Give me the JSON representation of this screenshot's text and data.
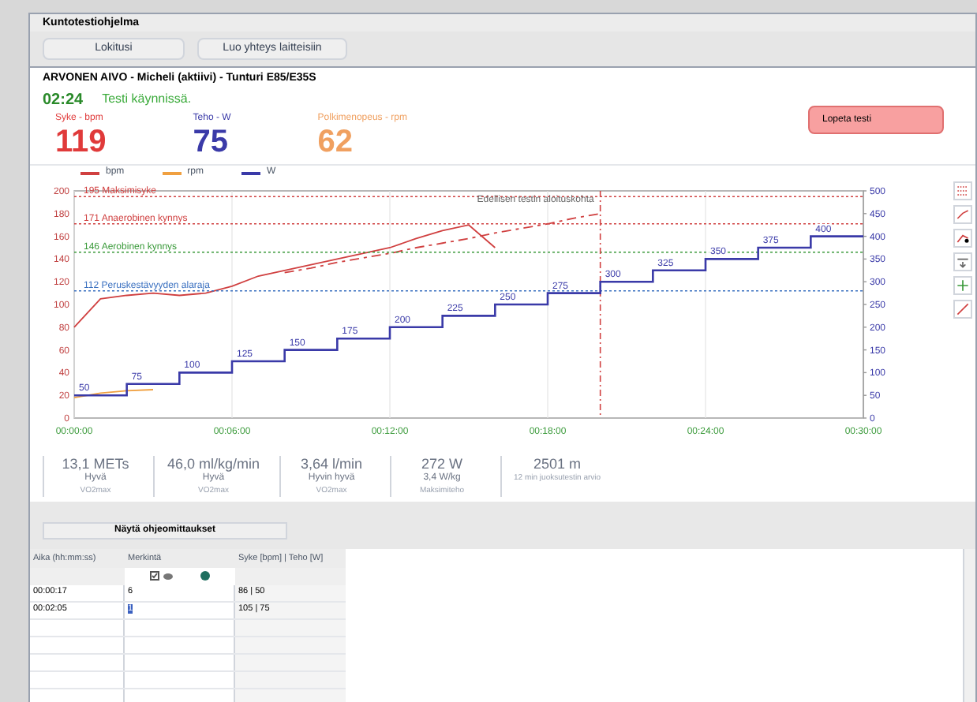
{
  "window": {
    "title": "Kuntotestiohjelma"
  },
  "toolbar": {
    "buttons": [
      "Lokitusi",
      "Luo yhteys laitteisiin"
    ]
  },
  "subject": "ARVONEN AIVO - Micheli (aktiivi) - Tunturi E85/E35S",
  "status": {
    "time": "02:24",
    "text": "Testi käynnissä."
  },
  "readouts": [
    {
      "label": "Syke - bpm",
      "value": "119",
      "color": "#e03a3a"
    },
    {
      "label": "Teho - W",
      "value": "75",
      "color": "#3a3aa8"
    },
    {
      "label": "Polkimenopeus - rpm",
      "value": "62",
      "color": "#f0a060"
    }
  ],
  "stop_button": "Lopeta testi",
  "chart": {
    "chart_data": {
      "type": "line",
      "x": [
        0,
        1,
        2,
        3,
        4,
        5,
        6,
        7,
        8,
        9,
        10,
        11,
        12,
        13,
        14,
        15,
        16,
        17,
        18,
        19,
        20
      ],
      "xticks": [
        {
          "value": 0,
          "label": "00:00:00"
        },
        {
          "value": 6,
          "label": "00:06:00"
        },
        {
          "value": 12,
          "label": "00:12:00"
        },
        {
          "value": 18,
          "label": "00:18:00"
        },
        {
          "value": 24,
          "label": "00:24:00"
        },
        {
          "value": 30,
          "label": "00:30:00"
        }
      ],
      "xlim": [
        0,
        30
      ],
      "ylim": [
        0,
        200
      ],
      "yticks": [
        0,
        20,
        40,
        60,
        80,
        100,
        120,
        140,
        160,
        180,
        200
      ],
      "grid": true,
      "series": [
        {
          "name": "bpm",
          "color": "#d04040",
          "values": [
            80,
            105,
            108,
            110,
            108,
            110,
            116,
            125,
            130,
            135,
            140,
            145,
            150,
            158,
            165,
            170,
            150,
            null,
            null,
            null,
            null
          ]
        },
        {
          "name": "rpm",
          "color": "#f0a040",
          "values": [
            18,
            22,
            24,
            25,
            null,
            null,
            null,
            null,
            null,
            null,
            null,
            null,
            null,
            null,
            null,
            null,
            null,
            null,
            null,
            null,
            null
          ]
        },
        {
          "color": "#d04040",
          "line_style": "dashed",
          "values": [
            null,
            null,
            null,
            null,
            null,
            null,
            null,
            null,
            128,
            132,
            137,
            141,
            145,
            150,
            154,
            158,
            163,
            167,
            171,
            176,
            180
          ]
        }
      ],
      "ref_lines": [
        {
          "axis": "y",
          "value": 195,
          "label": "195 Maksimisyke",
          "color": "#d04040"
        },
        {
          "axis": "y",
          "value": 171,
          "label": "171 Anaerobinen kynnys",
          "color": "#d04040"
        },
        {
          "axis": "y",
          "value": 146,
          "label": "146 Aerobinen kynnys",
          "color": "#3a9a3a"
        },
        {
          "axis": "y",
          "value": 112,
          "label": "112 Peruskestävyyden alaraja",
          "color": "#3a70c0"
        },
        {
          "axis": "x",
          "value": 20,
          "label": "Edellisen testin aloituskohta",
          "color": "#d04040"
        }
      ]
    }
  },
  "power_overlay": {
    "chart_data": {
      "type": "line",
      "x": [
        0,
        2,
        2,
        4,
        4,
        6,
        6,
        8,
        8,
        10,
        10,
        12,
        12,
        14,
        14,
        16,
        16,
        18,
        18,
        20,
        20,
        22,
        22,
        24,
        24,
        26,
        26,
        28,
        28,
        30
      ],
      "xlim": [
        0,
        30
      ],
      "ylim": [
        0,
        500
      ],
      "yticks": [
        0,
        50,
        100,
        150,
        200,
        250,
        300,
        350,
        400,
        450,
        500
      ],
      "series": [
        {
          "name": "W",
          "color": "#3a3aa8",
          "values": [
            50,
            50,
            75,
            75,
            100,
            100,
            125,
            125,
            150,
            150,
            175,
            175,
            200,
            200,
            225,
            225,
            250,
            250,
            275,
            275,
            300,
            300,
            325,
            325,
            350,
            350,
            375,
            375,
            400,
            400
          ]
        }
      ],
      "annotations": [
        {
          "x": 0,
          "y": 50,
          "text": "50"
        },
        {
          "x": 2,
          "y": 75,
          "text": "75"
        },
        {
          "x": 4,
          "y": 100,
          "text": "100"
        },
        {
          "x": 6,
          "y": 125,
          "text": "125"
        },
        {
          "x": 8,
          "y": 150,
          "text": "150"
        },
        {
          "x": 10,
          "y": 175,
          "text": "175"
        },
        {
          "x": 12,
          "y": 200,
          "text": "200"
        },
        {
          "x": 14,
          "y": 225,
          "text": "225"
        },
        {
          "x": 16,
          "y": 250,
          "text": "250"
        },
        {
          "x": 18,
          "y": 275,
          "text": "275"
        },
        {
          "x": 20,
          "y": 300,
          "text": "300"
        },
        {
          "x": 22,
          "y": 325,
          "text": "325"
        },
        {
          "x": 24,
          "y": 350,
          "text": "350"
        },
        {
          "x": 26,
          "y": 375,
          "text": "375"
        },
        {
          "x": 28,
          "y": 400,
          "text": "400"
        }
      ]
    }
  },
  "summary_cards": [
    {
      "value": "13,1 METs",
      "rating": "Hyvä",
      "caption": "VO2max"
    },
    {
      "value": "46,0 ml/kg/min",
      "rating": "Hyvä",
      "caption": "VO2max"
    },
    {
      "value": "3,64 l/min",
      "rating": "Hyvin hyvä",
      "caption": "VO2max"
    },
    {
      "value": "272 W",
      "rating": "3,4 W/kg",
      "caption": "Maksimiteho"
    },
    {
      "value": "2501 m",
      "caption": "12 min juoksutestin arvio"
    }
  ],
  "notes_button": "Näytä ohjeomittaukset",
  "table": {
    "columns": [
      "Aika (hh:mm:ss)",
      "Merkintä",
      "Syke [bpm] | Teho [W]"
    ],
    "rows": [
      {
        "time": "00:00:17",
        "mark": "6",
        "values": "86 | 50",
        "selected": false
      },
      {
        "time": "00:02:05",
        "mark": "1",
        "values": "105 | 75",
        "selected": true
      }
    ]
  }
}
